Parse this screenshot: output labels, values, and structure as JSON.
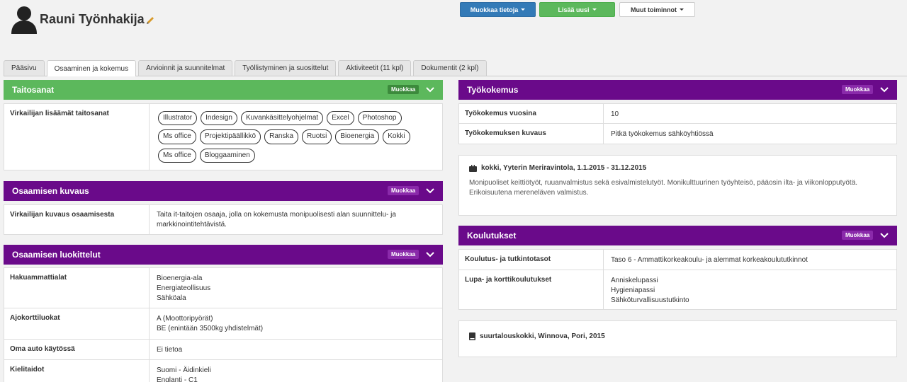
{
  "header": {
    "name": "Rauni Työnhakija",
    "buttons": {
      "edit_info": "Muokkaa tietoja",
      "add_new": "Lisää uusi",
      "other_actions": "Muut toiminnot"
    }
  },
  "tabs": [
    {
      "label": "Pääsivu"
    },
    {
      "label": "Osaaminen ja kokemus"
    },
    {
      "label": "Arvioinnit ja suunnitelmat"
    },
    {
      "label": "Työllistyminen ja suosittelut"
    },
    {
      "label": "Aktiviteetit (11 kpl)"
    },
    {
      "label": "Dokumentit (2 kpl)"
    }
  ],
  "edit_label": "Muokkaa",
  "skills": {
    "title": "Taitosanat",
    "row_label": "Virkailijan lisäämät taitosanat",
    "chips": [
      "Illustrator",
      "Indesign",
      "Kuvankäsittelyohjelmat",
      "Excel",
      "Photoshop",
      "Ms office",
      "Projektipäällikkö",
      "Ranska",
      "Ruotsi",
      "Bioenergia",
      "Kokki",
      "Ms office",
      "Bloggaaminen"
    ]
  },
  "description": {
    "title": "Osaamisen kuvaus",
    "row_label": "Virkailijan kuvaus osaamisesta",
    "text_line1": "Taita it-taitojen osaaja, jolla on kokemusta monipuolisesti alan suunnittelu- ja",
    "text_line2": "markkinointitehtävistä."
  },
  "classification": {
    "title": "Osaamisen luokittelut",
    "rows": [
      {
        "label": "Hakuammattialat",
        "values": [
          "Bioenergia-ala",
          "Energiateollisuus",
          "Sähköala"
        ]
      },
      {
        "label": "Ajokorttiluokat",
        "values": [
          "A (Moottoripyörät)",
          "BE (enintään 3500kg yhdistelmät)"
        ]
      },
      {
        "label": "Oma auto käytössä",
        "values": [
          "Ei tietoa"
        ]
      },
      {
        "label": "Kielitaidot",
        "values": [
          "Suomi - Äidinkieli",
          "Englanti - C1"
        ]
      }
    ]
  },
  "work": {
    "title": "Työkokemus",
    "rows": [
      {
        "label": "Työkokemus vuosina",
        "value": "10"
      },
      {
        "label": "Työkokemuksen kuvaus",
        "value": "Pitkä työkokemus sähköyhtiössä"
      }
    ],
    "entry": {
      "title": "kokki, Yyterin Meriravintola, 1.1.2015 - 31.12.2015",
      "line1": "Monipuoliset keittiötyöt, ruuanvalmistus sekä esivalmistelutyöt. Monikulttuurinen työyhteisö, pääosin ilta- ja viikonlopputyötä.",
      "line2": "Erikoisuutena mereneläven valmistus."
    }
  },
  "education": {
    "title": "Koulutukset",
    "rows": [
      {
        "label": "Koulutus- ja tutkintotasot",
        "values": [
          "Taso 6 - Ammattikorkeakoulu- ja alemmat korkeakoulututkinnot"
        ]
      },
      {
        "label": "Lupa- ja korttikoulutukset",
        "values": [
          "Anniskelupassi",
          "Hygieniapassi",
          "Sähköturvallisuustutkinto"
        ]
      }
    ],
    "entry": {
      "title": "suurtalouskokki, Winnova, Pori, 2015"
    }
  },
  "colors": {
    "green": "#5cb85c",
    "purple": "#6a0a8a",
    "blue": "#337ab7"
  }
}
